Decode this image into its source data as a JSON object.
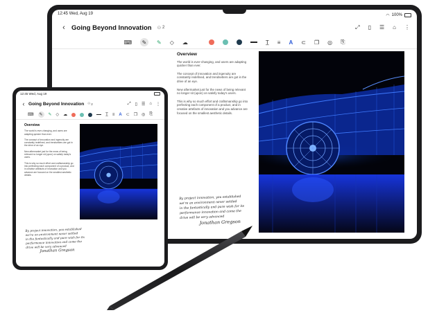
{
  "tablet": {
    "status_time": "12:45",
    "status_date": "Wed, Aug 19",
    "status_battery": "100%",
    "title": "Going Beyond Innovation",
    "collab_count": "2"
  },
  "fold": {
    "status_time": "12:45",
    "status_date": "Wed, Aug 19",
    "title": "Going Beyond Innovation",
    "collab_count": "2"
  },
  "note": {
    "heading": "Overview",
    "paragraphs": [
      "The world is ever-changing, and users are adapting quicker than ever.",
      "The concept of innovation and ingenuity are constantly redefined, and trendsetters are got in the drive of an eye.",
      "New aftermarket just for the news of being relevant no longer sit (upon) on satisfy today's users.",
      "This is why so much effort and craftsmanship go into perfecting each component of a product, and in creative artefacts of innovation and you advance are focused on the smallest aesthetic details."
    ],
    "handwriting": [
      "By project innovation, you established",
      "we're an environment never settled",
      "in the fantastically and pure wish for its",
      "performance innovation and come the",
      "drive will be very advanced"
    ],
    "signature": "Jonathan Gregson"
  },
  "colors": {
    "swatch_red": "#ef6c5a",
    "swatch_teal": "#6bbfb2",
    "swatch_navy": "#1f3a4d",
    "accent_blue": "#2d8cff",
    "frame": "#1c1c1e"
  },
  "icons": {
    "back": "back-arrow-icon",
    "people": "people-icon",
    "pen": "pen-icon",
    "eraser": "eraser-icon",
    "highlighter": "highlighter-icon",
    "shape": "cloud-shape-icon",
    "keyboard": "keyboard-icon",
    "text": "text-style-icon",
    "lasso": "lasso-icon",
    "image": "image-icon",
    "audio": "audio-icon",
    "pdf": "pdf-icon",
    "more": "more-icon"
  }
}
